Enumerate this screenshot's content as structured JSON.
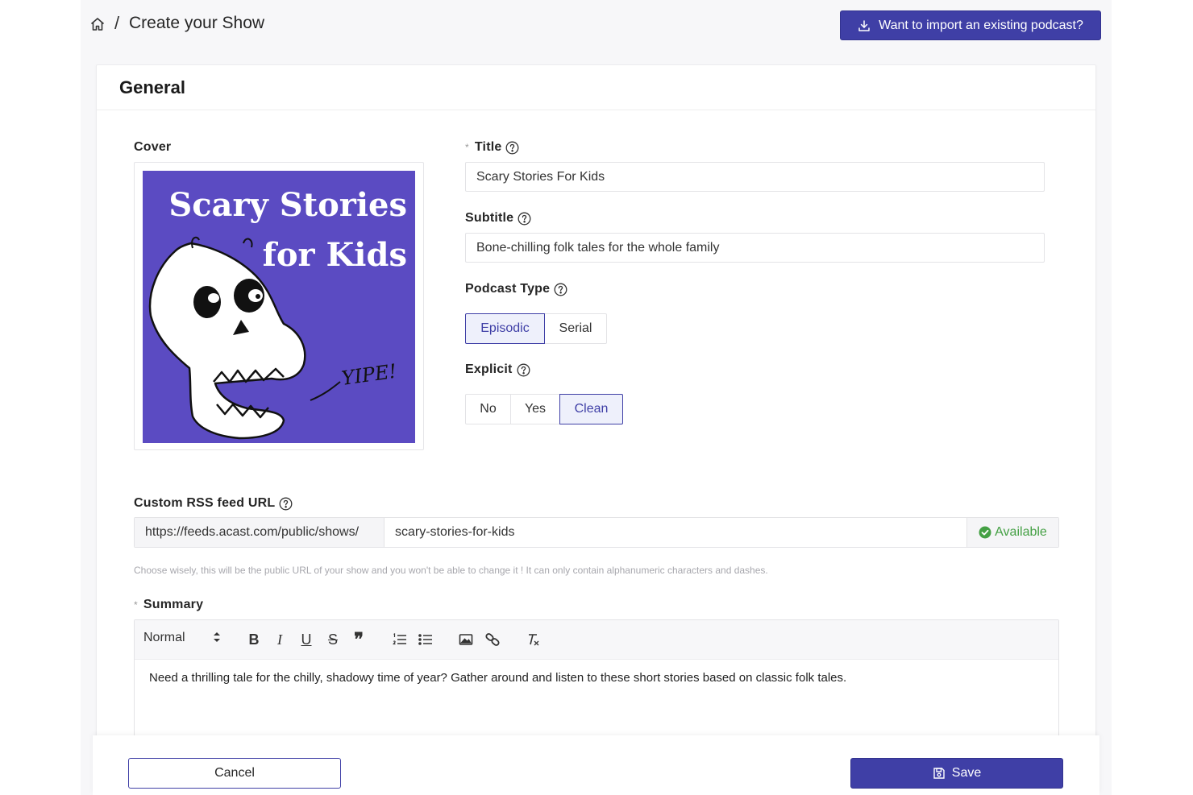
{
  "header": {
    "separator": "/",
    "title": "Create your Show",
    "import_label": "Want to import an existing podcast?"
  },
  "card": {
    "title": "General"
  },
  "cover": {
    "label": "Cover",
    "art_title_line1": "Scary Stories",
    "art_title_line2": "for Kids",
    "art_caption": "YIPE!"
  },
  "fields": {
    "title": {
      "label": "Title",
      "required_mark": "*",
      "value": "Scary Stories For Kids"
    },
    "subtitle": {
      "label": "Subtitle",
      "value": "Bone-chilling folk tales for the whole family"
    },
    "podcast_type": {
      "label": "Podcast Type",
      "options": [
        "Episodic",
        "Serial"
      ],
      "selected": "Episodic"
    },
    "explicit": {
      "label": "Explicit",
      "options": [
        "No",
        "Yes",
        "Clean"
      ],
      "selected": "Clean"
    }
  },
  "rss": {
    "label": "Custom RSS feed URL",
    "prefix": "https://feeds.acast.com/public/shows/",
    "slug": "scary-stories-for-kids",
    "status": "Available",
    "hint": "Choose wisely, this will be the public URL of your show and you won't be able to change it ! It can only contain alphanumeric characters and dashes."
  },
  "summary": {
    "label": "Summary",
    "required_mark": "*",
    "format": "Normal",
    "text": "Need a thrilling tale for the chilly, shadowy time of year? Gather around and listen to these short stories based on classic folk tales."
  },
  "footer": {
    "cancel_label": "Cancel",
    "save_label": "Save"
  },
  "colors": {
    "accent": "#3f3fa6",
    "cover_bg": "#5b4bc2",
    "available": "#44a044"
  }
}
